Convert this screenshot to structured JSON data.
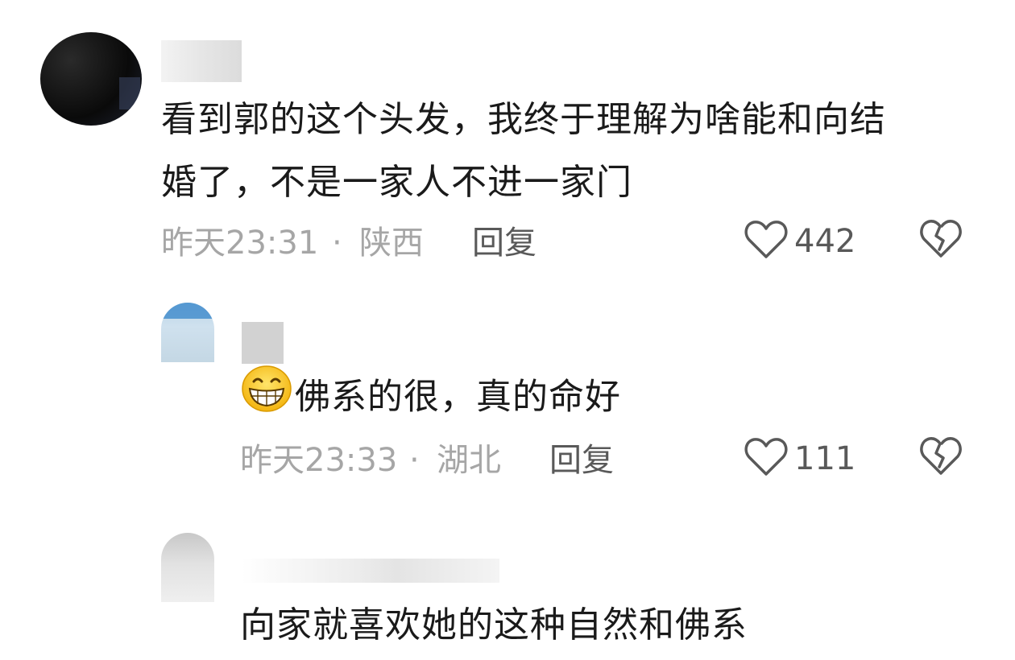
{
  "comments": [
    {
      "text": "看到郭的这个头发，我终于理解为啥能和向结婚了，不是一家人不进一家门",
      "line1": "看到郭的这个头发，我终于理解为啥能和向结",
      "line2": "婚了，不是一家人不进一家门",
      "time": "昨天23:31",
      "separator": "·",
      "location": "陕西",
      "reply_label": "回复",
      "likes": "442"
    },
    {
      "text": "佛系的很，真的命好",
      "emoji": "grinning-face-icon",
      "time": "昨天23:33",
      "separator": "·",
      "location": "湖北",
      "reply_label": "回复",
      "likes": "111"
    },
    {
      "text": "向家就喜欢她的这种自然和佛系"
    }
  ],
  "colors": {
    "text": "#1a1a1a",
    "meta": "#a6a6a6",
    "action": "#595959",
    "background": "#ffffff"
  }
}
